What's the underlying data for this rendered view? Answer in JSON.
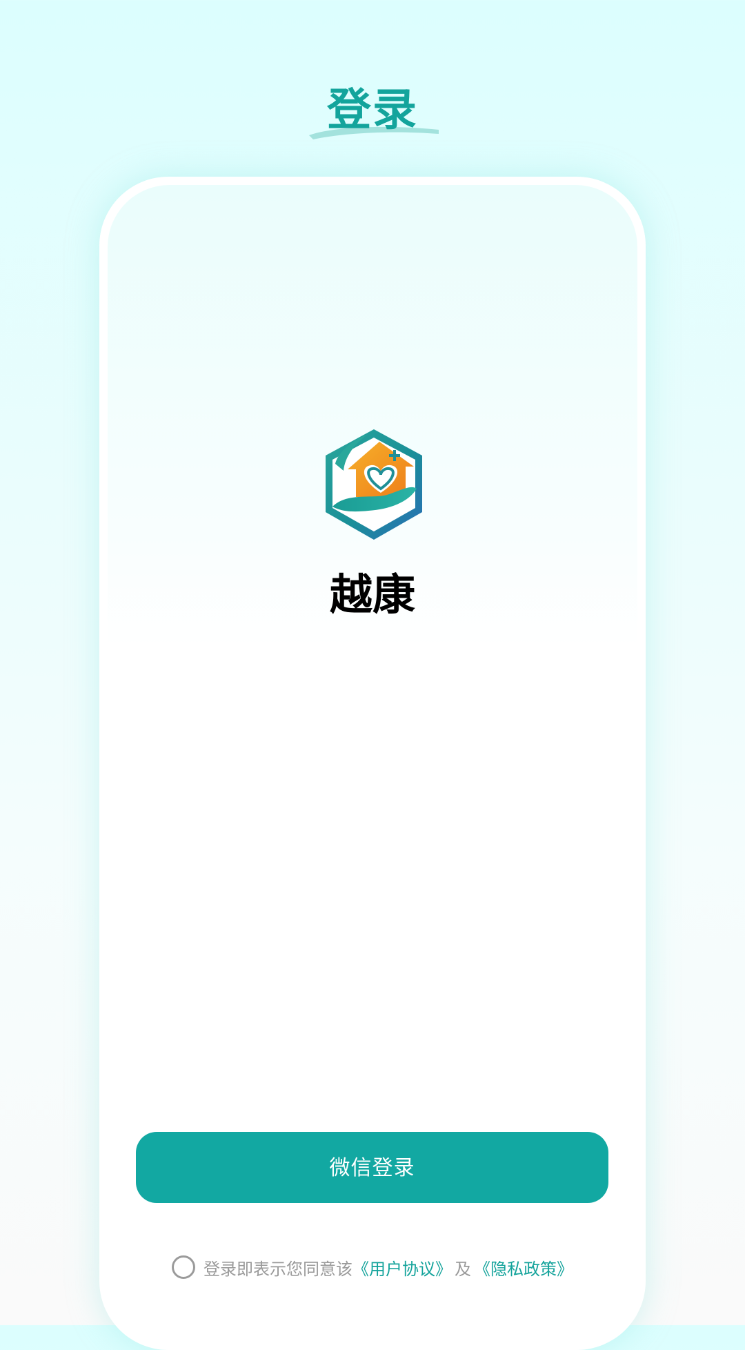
{
  "header": {
    "title": "登录"
  },
  "brand": {
    "name": "越康",
    "logo_icon": "house-heart-hand-logo-icon"
  },
  "login_button": {
    "label": "微信登录"
  },
  "agreement": {
    "prefix": "登录即表示您同意该",
    "user_agreement": "《用户协议》",
    "connector": "及",
    "privacy_policy": "《隐私政策》",
    "checked": false
  },
  "colors": {
    "accent": "#12a8a2",
    "title": "#13a49c",
    "logo_orange": "#f39a1e",
    "logo_teal": "#1aa59a",
    "logo_blue": "#2576b8"
  }
}
